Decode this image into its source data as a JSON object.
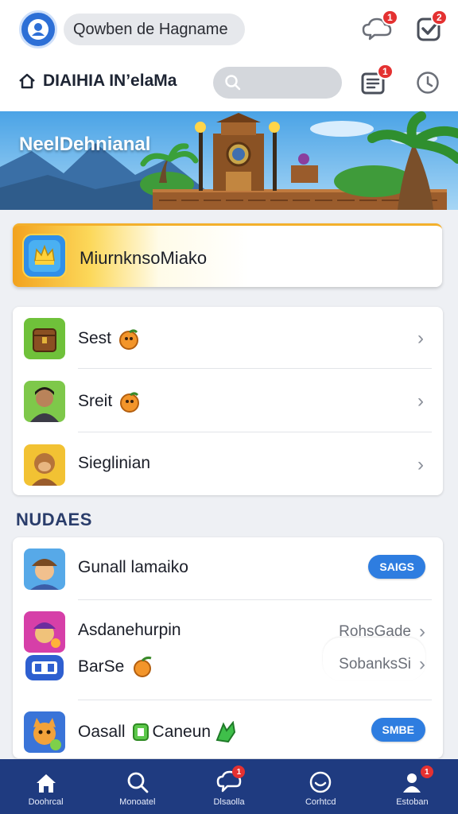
{
  "header": {
    "account_name": "Qowben de Hagname",
    "notif_badge": "1",
    "check_badge": "2",
    "brand": "DIAIHIA IN’elaMa",
    "list_badge": "1",
    "search_placeholder": ""
  },
  "banner": {
    "title": "NeelDehnianal"
  },
  "featured": {
    "label": "MiurnknsoMiako"
  },
  "menu": [
    {
      "label": "Sest"
    },
    {
      "label": "Sreit"
    },
    {
      "label": "Sieglinian"
    }
  ],
  "updates": {
    "title": "NUDAES",
    "items": [
      {
        "label": "Gunall lamaiko",
        "action": "SAIGS"
      },
      {
        "label": "Asdanehurpin",
        "meta": "RohsGade"
      },
      {
        "label": "BarSe",
        "meta": "SobanksSi"
      },
      {
        "label": "Oasall",
        "tag": "Caneun",
        "action": "SMBE"
      }
    ]
  },
  "nav": [
    {
      "label": "Doohrcal"
    },
    {
      "label": "Monoatel"
    },
    {
      "label": "Dlsaolla",
      "badge": "1"
    },
    {
      "label": "Corhtcd"
    },
    {
      "label": "Estoban",
      "badge": "1"
    }
  ],
  "colors": {
    "accent": "#2e7de0",
    "nav_bg": "#1f3b80",
    "badge": "#e43131",
    "section": "#2a3d6b"
  }
}
